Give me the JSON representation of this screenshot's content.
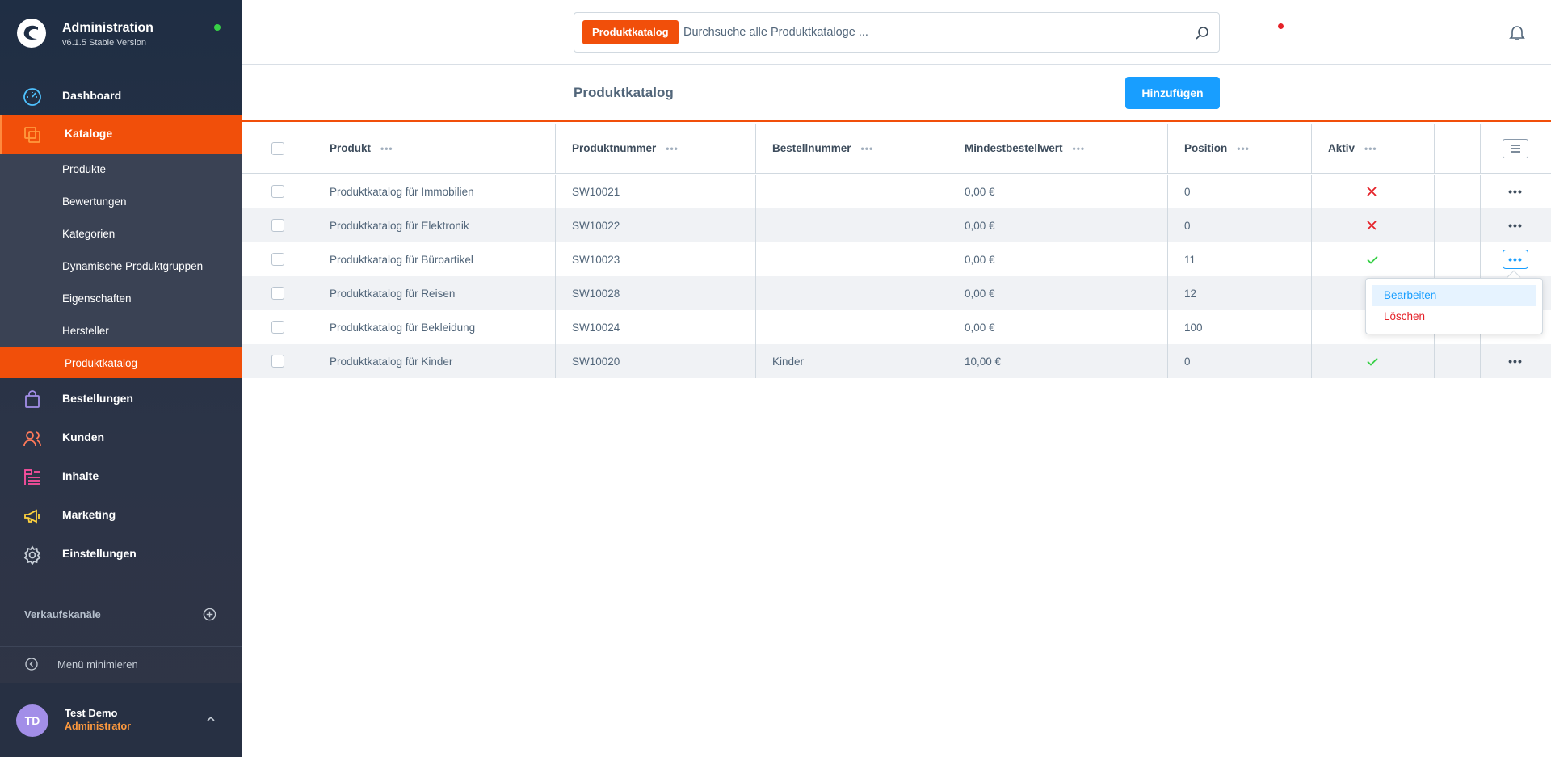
{
  "app": {
    "title": "Administration",
    "version": "v6.1.5 Stable Version"
  },
  "sidebar": {
    "main_items": [
      {
        "label": "Dashboard",
        "icon": "gauge-icon",
        "color": "#4fc2ff"
      },
      {
        "label": "Kataloge",
        "icon": "catalog-icon",
        "color": "#ff9a3e",
        "active": true
      },
      {
        "label": "Bestellungen",
        "icon": "shopping-bag-icon",
        "color": "#a28ee8"
      },
      {
        "label": "Kunden",
        "icon": "users-icon",
        "color": "#ff7a5a"
      },
      {
        "label": "Inhalte",
        "icon": "content-list-icon",
        "color": "#ff4fa0"
      },
      {
        "label": "Marketing",
        "icon": "megaphone-icon",
        "color": "#ffd23e"
      },
      {
        "label": "Einstellungen",
        "icon": "gear-icon",
        "color": "#c6cdd6"
      }
    ],
    "sub_items": [
      {
        "label": "Produkte"
      },
      {
        "label": "Bewertungen"
      },
      {
        "label": "Kategorien"
      },
      {
        "label": "Dynamische Produktgruppen"
      },
      {
        "label": "Eigenschaften"
      },
      {
        "label": "Hersteller"
      },
      {
        "label": "Produktkatalog",
        "active": true
      }
    ],
    "sales_channels_label": "Verkaufskanäle",
    "minimize_label": "Menü minimieren",
    "user": {
      "initials": "TD",
      "name": "Test Demo",
      "role": "Administrator"
    }
  },
  "search": {
    "tag": "Produktkatalog",
    "placeholder": "Durchsuche alle Produktkataloge ..."
  },
  "page": {
    "title": "Produktkatalog",
    "add_button": "Hinzufügen"
  },
  "table": {
    "columns": [
      {
        "label": "Produkt"
      },
      {
        "label": "Produktnummer"
      },
      {
        "label": "Bestellnummer"
      },
      {
        "label": "Mindestbestellwert"
      },
      {
        "label": "Position"
      },
      {
        "label": "Aktiv"
      }
    ],
    "rows": [
      {
        "product": "Produktkatalog für Immobilien",
        "number": "SW10021",
        "order_number": "",
        "min_value": "0,00 €",
        "position": "0",
        "active": false
      },
      {
        "product": "Produktkatalog für Elektronik",
        "number": "SW10022",
        "order_number": "",
        "min_value": "0,00 €",
        "position": "0",
        "active": false
      },
      {
        "product": "Produktkatalog für Büroartikel",
        "number": "SW10023",
        "order_number": "",
        "min_value": "0,00 €",
        "position": "11",
        "active": true
      },
      {
        "product": "Produktkatalog für Reisen",
        "number": "SW10028",
        "order_number": "",
        "min_value": "0,00 €",
        "position": "12",
        "active": null
      },
      {
        "product": "Produktkatalog für Bekleidung",
        "number": "SW10024",
        "order_number": "",
        "min_value": "0,00 €",
        "position": "100",
        "active": null
      },
      {
        "product": "Produktkatalog für Kinder",
        "number": "SW10020",
        "order_number": "Kinder",
        "min_value": "10,00 €",
        "position": "0",
        "active": true
      }
    ]
  },
  "context_menu": {
    "edit": "Bearbeiten",
    "delete": "Löschen"
  },
  "colors": {
    "accent": "#f14f0a",
    "primary": "#189eff",
    "danger": "#e52229",
    "success": "#37d046"
  }
}
